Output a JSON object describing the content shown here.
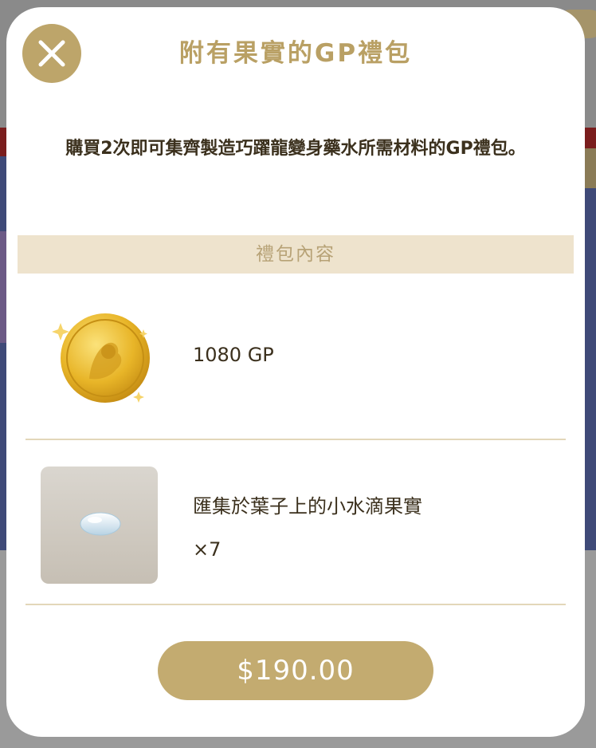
{
  "modal": {
    "title": "附有果實的GP禮包",
    "description": "購買2次即可集齊製造巧躍龍變身藥水所需材料的GP禮包。",
    "section_header": "禮包內容",
    "close_icon": "close-icon"
  },
  "items": [
    {
      "name": "1080 GP",
      "icon": "gold-coin-icon"
    },
    {
      "name": "匯集於葉子上的小水滴果實",
      "quantity": "×7",
      "icon": "water-drop-icon"
    }
  ],
  "purchase": {
    "price_label": "$190.00"
  },
  "colors": {
    "accent": "#c3ab70",
    "title": "#b9a064",
    "section_bg": "#eee3cd",
    "text": "#3b301d"
  }
}
